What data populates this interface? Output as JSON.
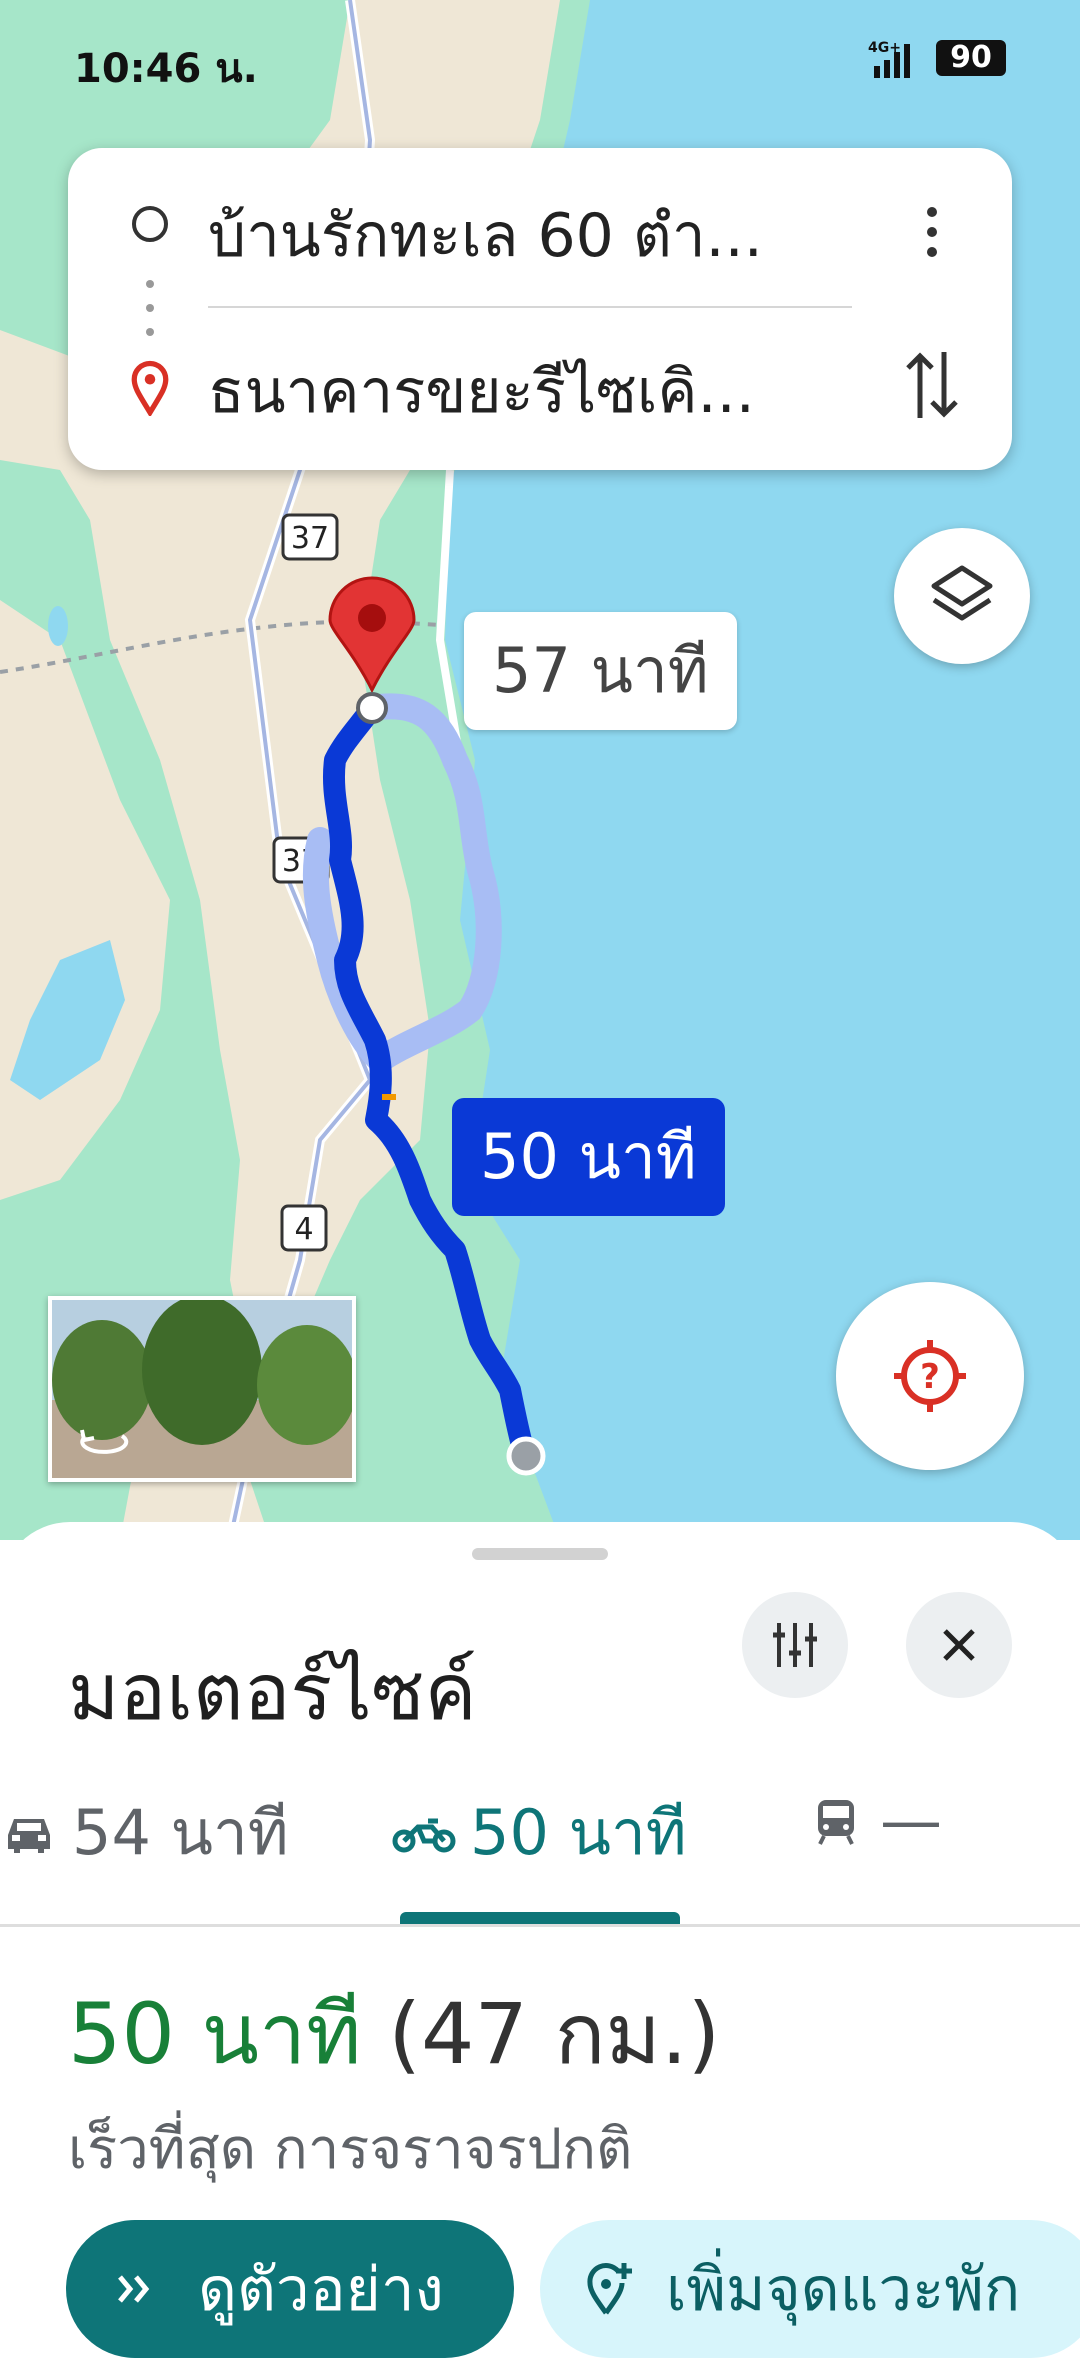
{
  "status_bar": {
    "time": "10:46 น.",
    "network": "4G+",
    "battery": "90"
  },
  "search": {
    "origin": "บ้านรักทะเล 60 ตำ...",
    "destination": "ธนาคารขยะรีไซเคิ..."
  },
  "map": {
    "route_labels": {
      "alternate": "57 นาที",
      "selected": "50 นาที"
    },
    "road_shields": [
      "37",
      "37",
      "4"
    ]
  },
  "sheet": {
    "title": "มอเตอร์ไซค์",
    "tabs": [
      {
        "icon": "car-icon",
        "label": "54 นาที"
      },
      {
        "icon": "motorcycle-icon",
        "label": "50 นาที"
      },
      {
        "icon": "transit-icon",
        "label": "—"
      }
    ],
    "summary": {
      "duration": "50 นาที",
      "distance": "(47 กม.)"
    },
    "subtitle": "เร็วที่สุด การจราจรปกติ",
    "buttons": {
      "preview": "ดูตัวอย่าง",
      "add_stop": "เพิ่มจุดแวะพัก"
    }
  },
  "colors": {
    "accent": "#0e7578",
    "route": "#0a39d6",
    "duration": "#188038",
    "sea": "#8fd8f0",
    "land": "#a6e6c9"
  }
}
